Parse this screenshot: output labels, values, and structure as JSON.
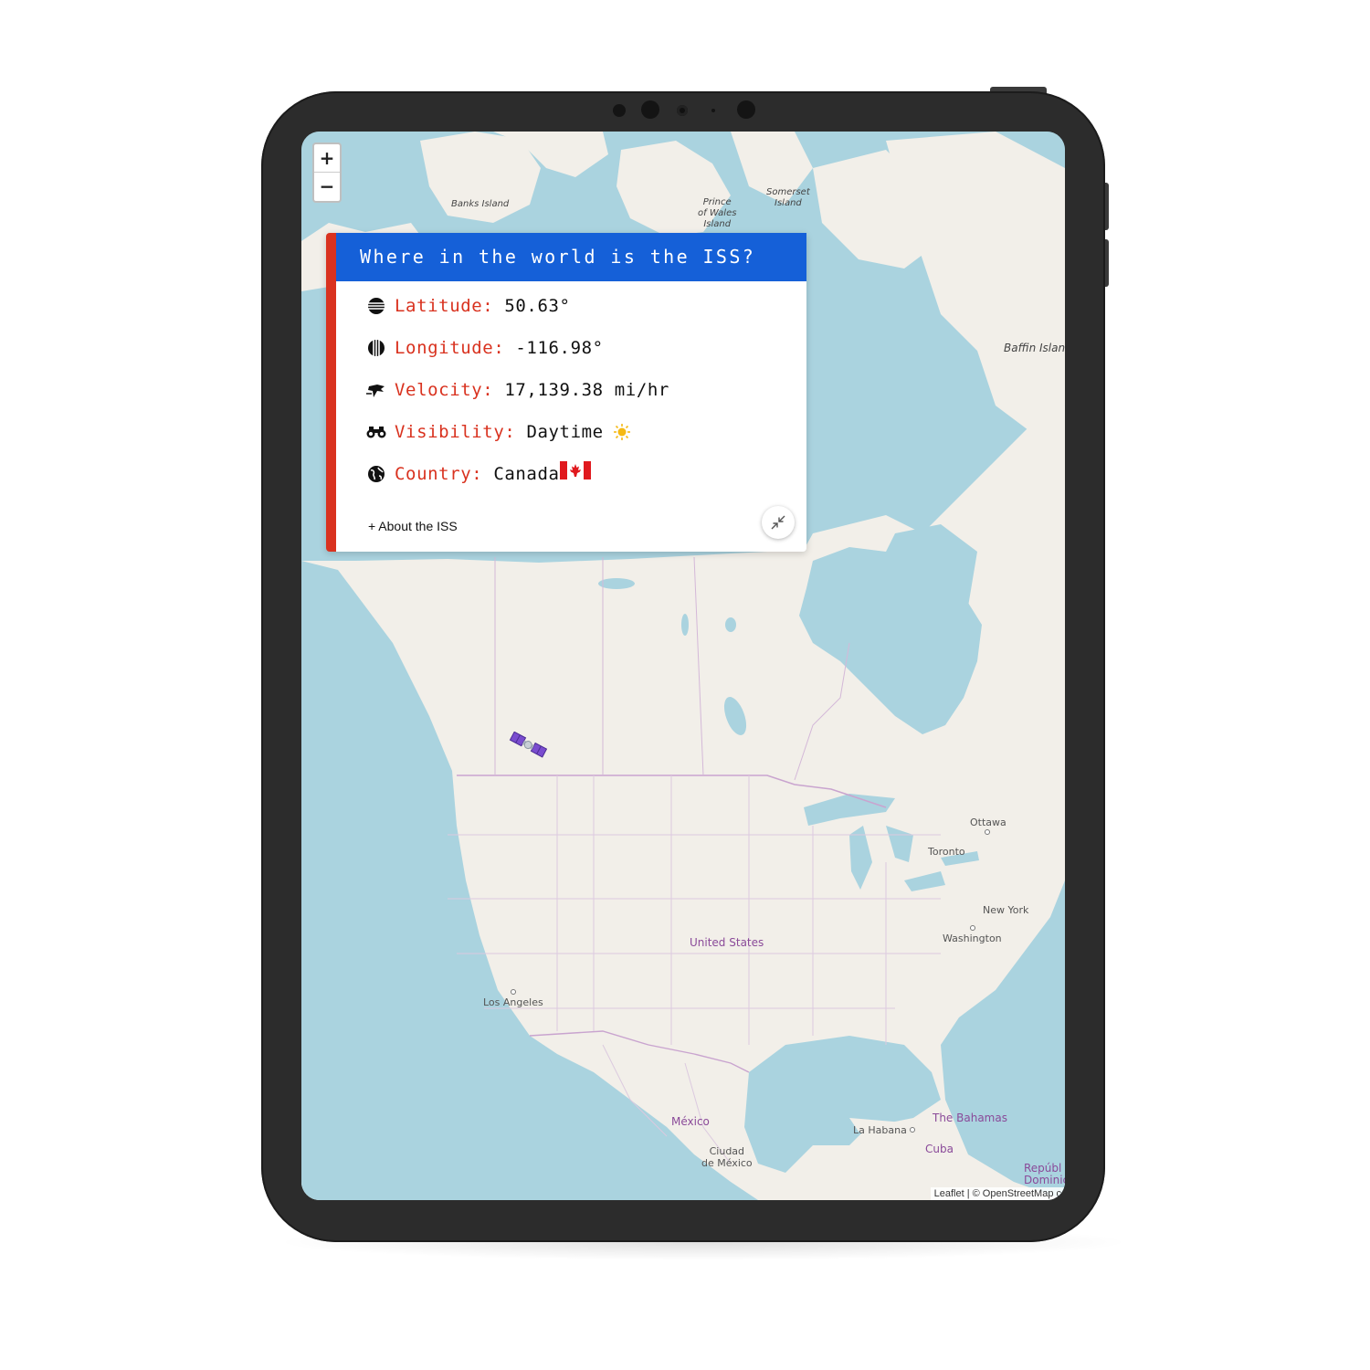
{
  "panel": {
    "title": "Where in the world is the ISS?",
    "latitude_label": "Latitude:",
    "latitude_value": "50.63°",
    "longitude_label": "Longitude:",
    "longitude_value": "-116.98°",
    "velocity_label": "Velocity:",
    "velocity_value": "17,139.38 mi/hr",
    "visibility_label": "Visibility:",
    "visibility_value": "Daytime",
    "country_label": "Country:",
    "country_value": "Canada",
    "about_label": "+ About the ISS"
  },
  "zoom": {
    "in_label": "+",
    "out_label": "−"
  },
  "map": {
    "places": {
      "banks_island": "Banks Island",
      "prince_of_wales_1": "Prince",
      "prince_of_wales_2": "of Wales",
      "prince_of_wales_3": "Island",
      "somerset_1": "Somerset",
      "somerset_2": "Island",
      "baffin": "Baffin Islan",
      "ottawa": "Ottawa",
      "toronto": "Toronto",
      "new_york": "New York",
      "washington": "Washington",
      "united_states": "United States",
      "los_angeles": "Los Angeles",
      "mexico": "México",
      "ciudad_1": "Ciudad",
      "ciudad_2": "de México",
      "la_habana": "La Habana",
      "cuba": "Cuba",
      "bahamas": "The Bahamas",
      "republica_1": "Repúbl",
      "republica_2": "Dominic"
    },
    "attribution": "Leaflet | © OpenStreetMap c"
  },
  "colors": {
    "header": "#1560d8",
    "accent": "#d9321f",
    "water": "#aad3df",
    "land": "#f2efe9"
  },
  "icons": {
    "latitude": "latitude-lines-icon",
    "longitude": "longitude-lines-icon",
    "velocity": "velocity-icon",
    "visibility": "binoculars-icon",
    "country": "globe-icon",
    "visibility_value": "sun-icon",
    "country_value": "canada-flag-icon",
    "collapse": "compress-icon",
    "marker": "satellite-icon"
  }
}
